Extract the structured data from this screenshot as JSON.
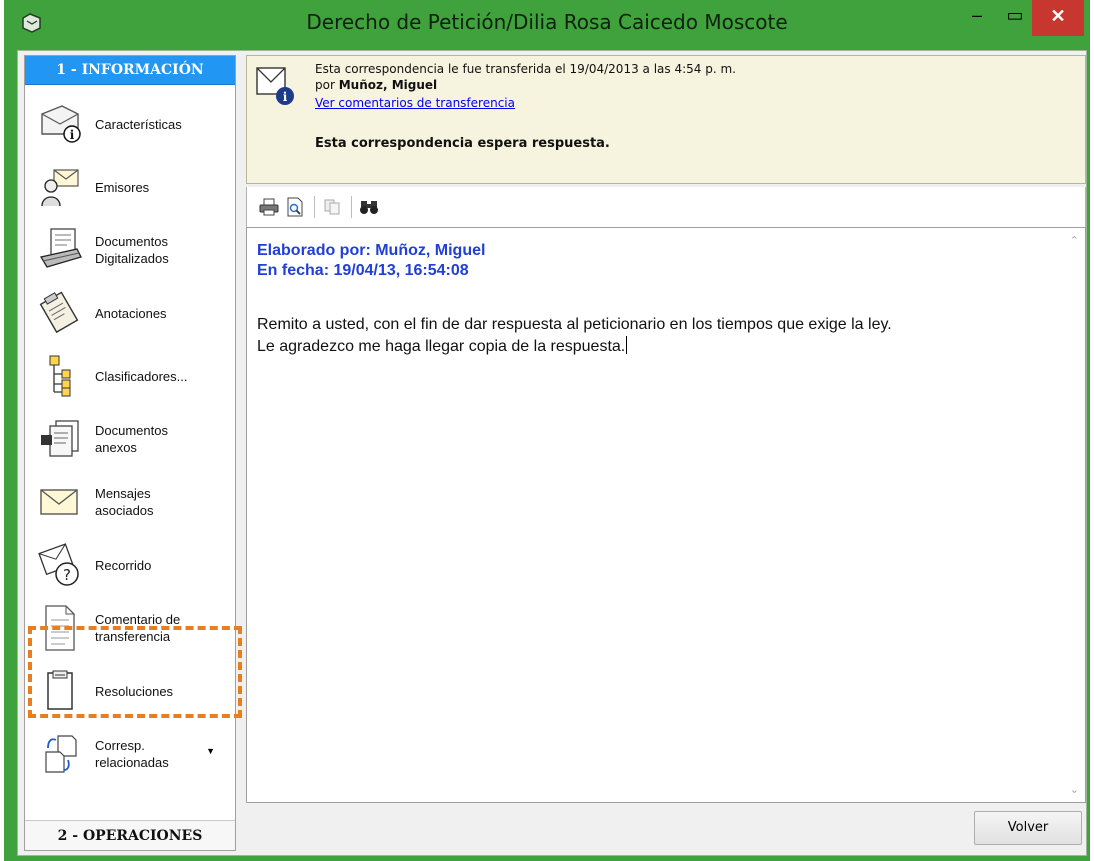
{
  "window": {
    "title": "Derecho de Petición/Dilia Rosa Caicedo Moscote",
    "min_glyph": "–",
    "max_glyph": "▭",
    "close_glyph": "✕"
  },
  "sidebar": {
    "header": "1 - INFORMACIÓN",
    "footer": "2 - OPERACIONES",
    "items": [
      {
        "label": "Características",
        "icon": "envelope-info-icon"
      },
      {
        "label": "Emisores",
        "icon": "sender-person-icon"
      },
      {
        "label": "Documentos\nDigitalizados",
        "icon": "scanner-icon"
      },
      {
        "label": "Anotaciones",
        "icon": "clipboard-annotations-icon"
      },
      {
        "label": "Clasificadores...",
        "icon": "tree-classifier-icon"
      },
      {
        "label": "Documentos\nanexos",
        "icon": "attached-documents-icon"
      },
      {
        "label": "Mensajes\nasociados",
        "icon": "envelope-icon"
      },
      {
        "label": "Recorrido",
        "icon": "route-question-icon"
      },
      {
        "label": "Comentario de\ntransferencia",
        "icon": "document-comment-icon"
      },
      {
        "label": "Resoluciones",
        "icon": "document-resolution-icon"
      },
      {
        "label": "Corresp.\nrelacionadas",
        "icon": "related-correspondence-icon"
      }
    ]
  },
  "notice": {
    "line1": "Esta correspondencia le fue transferida el 19/04/2013 a las 4:54 p. m.",
    "line2_prefix": "por ",
    "line2_name": "Muñoz, Miguel",
    "link": "Ver comentarios de transferencia",
    "status": "Esta correspondencia espera respuesta."
  },
  "editor": {
    "author_line": "Elaborado por: Muñoz, Miguel",
    "date_line": "En fecha: 19/04/13, 16:54:08",
    "body_line1": "Remito a usted, con el fin de dar respuesta al peticionario en los tiempos que exige la ley.",
    "body_line2": "Le agradezco me haga llegar copia de la respuesta."
  },
  "buttons": {
    "volver": "Volver"
  },
  "colors": {
    "frame": "#3fa23c",
    "sidebar_header": "#2196f3",
    "highlight": "#e67e22",
    "editor_heading": "#1f3fd6",
    "close_button": "#c7372f"
  }
}
